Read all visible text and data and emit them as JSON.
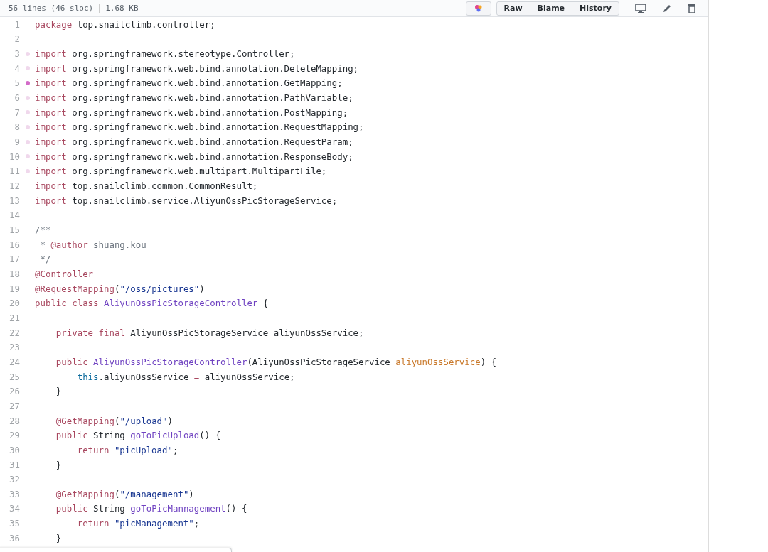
{
  "file_header": {
    "info": "56 lines (46 sloc)",
    "size": "1.68 KB",
    "buttons": [
      "Raw",
      "Blame",
      "History"
    ]
  },
  "lines": [
    {
      "n": "1",
      "changed": false,
      "highlighted": false,
      "tokens": [
        {
          "kind": "kw",
          "t": "package"
        },
        {
          "kind": "plain",
          "t": " top.snailclimb.controller;"
        }
      ]
    },
    {
      "n": "2",
      "changed": false,
      "highlighted": false
    },
    {
      "n": "3",
      "changed": true,
      "highlighted": false,
      "tokens": [
        {
          "kind": "kw",
          "t": "import"
        },
        {
          "kind": "plain",
          "t": " org.springframework.stereotype.Controller;"
        }
      ]
    },
    {
      "n": "4",
      "changed": true,
      "highlighted": false,
      "tokens": [
        {
          "kind": "kw",
          "t": "import"
        },
        {
          "kind": "plain",
          "t": " org.springframework.web.bind.annotation.DeleteMapping;"
        }
      ]
    },
    {
      "n": "5",
      "changed": true,
      "highlighted": true,
      "tokens": [
        {
          "kind": "kw",
          "t": "import "
        },
        {
          "kind": "link",
          "t": "org.springframework.web.bind.annotation.GetMapping"
        },
        {
          "kind": "plain",
          "t": ";"
        }
      ]
    },
    {
      "n": "6",
      "changed": true,
      "highlighted": false,
      "tokens": [
        {
          "kind": "kw",
          "t": "import"
        },
        {
          "kind": "plain",
          "t": " org.springframework.web.bind.annotation.PathVariable;"
        }
      ]
    },
    {
      "n": "7",
      "changed": true,
      "highlighted": false,
      "tokens": [
        {
          "kind": "kw",
          "t": "import"
        },
        {
          "kind": "plain",
          "t": " org.springframework.web.bind.annotation.PostMapping;"
        }
      ]
    },
    {
      "n": "8",
      "changed": true,
      "highlighted": false,
      "tokens": [
        {
          "kind": "kw",
          "t": "import"
        },
        {
          "kind": "plain",
          "t": " org.springframework.web.bind.annotation.RequestMapping;"
        }
      ]
    },
    {
      "n": "9",
      "changed": true,
      "highlighted": false,
      "tokens": [
        {
          "kind": "kw",
          "t": "import"
        },
        {
          "kind": "plain",
          "t": " org.springframework.web.bind.annotation.RequestParam;"
        }
      ]
    },
    {
      "n": "10",
      "changed": true,
      "highlighted": false,
      "tokens": [
        {
          "kind": "kw",
          "t": "import"
        },
        {
          "kind": "plain",
          "t": " org.springframework.web.bind.annotation.ResponseBody;"
        }
      ]
    },
    {
      "n": "11",
      "changed": true,
      "highlighted": false,
      "tokens": [
        {
          "kind": "kw",
          "t": "import"
        },
        {
          "kind": "plain",
          "t": " org.springframework.web.multipart.MultipartFile;"
        }
      ]
    },
    {
      "n": "12",
      "changed": false,
      "highlighted": false,
      "tokens": [
        {
          "kind": "kw",
          "t": "import"
        },
        {
          "kind": "plain",
          "t": " top.snailclimb.common.CommonResult;"
        }
      ]
    },
    {
      "n": "13",
      "changed": false,
      "highlighted": false,
      "tokens": [
        {
          "kind": "kw",
          "t": "import"
        },
        {
          "kind": "plain",
          "t": " top.snailclimb.service.AliyunOssPicStorageService;"
        }
      ]
    },
    {
      "n": "14",
      "changed": false,
      "highlighted": false
    },
    {
      "n": "15",
      "changed": false,
      "highlighted": false,
      "tokens": [
        {
          "kind": "comment",
          "t": "/**"
        }
      ]
    },
    {
      "n": "16",
      "changed": false,
      "highlighted": false,
      "tokens": [
        {
          "kind": "comment",
          "t": " * "
        },
        {
          "kind": "kw",
          "t": "@author"
        },
        {
          "kind": "comment",
          "t": " shuang.kou"
        }
      ]
    },
    {
      "n": "17",
      "changed": false,
      "highlighted": false,
      "tokens": [
        {
          "kind": "comment",
          "t": " */"
        }
      ]
    },
    {
      "n": "18",
      "changed": false,
      "highlighted": false,
      "tokens": [
        {
          "kind": "kw",
          "t": "@Controller"
        }
      ]
    },
    {
      "n": "19",
      "changed": false,
      "highlighted": false,
      "tokens": [
        {
          "kind": "kw",
          "t": "@RequestMapping"
        },
        {
          "kind": "plain",
          "t": "("
        },
        {
          "kind": "str",
          "t": "\"/oss/pictures\""
        },
        {
          "kind": "plain",
          "t": ")"
        }
      ]
    },
    {
      "n": "20",
      "changed": false,
      "highlighted": false,
      "tokens": [
        {
          "kind": "kw",
          "t": "public"
        },
        {
          "kind": "kw",
          "t": " class"
        },
        {
          "kind": "cls",
          "t": " AliyunOssPicStorageController"
        },
        {
          "kind": "plain",
          "t": " {"
        }
      ]
    },
    {
      "n": "21",
      "changed": false,
      "highlighted": false
    },
    {
      "n": "22",
      "changed": false,
      "highlighted": false,
      "tokens": [
        {
          "kind": "kw",
          "t": "    private"
        },
        {
          "kind": "kw",
          "t": " final"
        },
        {
          "kind": "plain",
          "t": " AliyunOssPicStorageService aliyunOssService;"
        }
      ]
    },
    {
      "n": "23",
      "changed": false,
      "highlighted": false
    },
    {
      "n": "24",
      "changed": false,
      "highlighted": false,
      "tokens": [
        {
          "kind": "kw",
          "t": "    public"
        },
        {
          "kind": "cls",
          "t": " AliyunOssPicStorageController"
        },
        {
          "kind": "plain",
          "t": "(AliyunOssPicStorageService "
        },
        {
          "kind": "param",
          "t": "aliyunOssService"
        },
        {
          "kind": "plain",
          "t": ") {"
        }
      ]
    },
    {
      "n": "25",
      "changed": false,
      "highlighted": false,
      "tokens": [
        {
          "kind": "this",
          "t": "        this"
        },
        {
          "kind": "plain",
          "t": ".aliyunOssService "
        },
        {
          "kind": "kw",
          "t": "="
        },
        {
          "kind": "plain",
          "t": " aliyunOssService;"
        }
      ]
    },
    {
      "n": "26",
      "changed": false,
      "highlighted": false,
      "tokens": [
        {
          "kind": "plain",
          "t": "    }"
        }
      ]
    },
    {
      "n": "27",
      "changed": false,
      "highlighted": false
    },
    {
      "n": "28",
      "changed": false,
      "highlighted": false,
      "tokens": [
        {
          "kind": "kw",
          "t": "    @GetMapping"
        },
        {
          "kind": "plain",
          "t": "("
        },
        {
          "kind": "str",
          "t": "\"/upload\""
        },
        {
          "kind": "plain",
          "t": ")"
        }
      ]
    },
    {
      "n": "29",
      "changed": false,
      "highlighted": false,
      "tokens": [
        {
          "kind": "kw",
          "t": "    public"
        },
        {
          "kind": "plain",
          "t": " String "
        },
        {
          "kind": "cls",
          "t": "goToPicUpload"
        },
        {
          "kind": "plain",
          "t": "() {"
        }
      ]
    },
    {
      "n": "30",
      "changed": false,
      "highlighted": false,
      "tokens": [
        {
          "kind": "kw",
          "t": "        return"
        },
        {
          "kind": "str",
          "t": " \"picUpload\""
        },
        {
          "kind": "plain",
          "t": ";"
        }
      ]
    },
    {
      "n": "31",
      "changed": false,
      "highlighted": false,
      "tokens": [
        {
          "kind": "plain",
          "t": "    }"
        }
      ]
    },
    {
      "n": "32",
      "changed": false,
      "highlighted": false
    },
    {
      "n": "33",
      "changed": false,
      "highlighted": false,
      "tokens": [
        {
          "kind": "kw",
          "t": "    @GetMapping"
        },
        {
          "kind": "plain",
          "t": "("
        },
        {
          "kind": "str",
          "t": "\"/management\""
        },
        {
          "kind": "plain",
          "t": ")"
        }
      ]
    },
    {
      "n": "34",
      "changed": false,
      "highlighted": false,
      "tokens": [
        {
          "kind": "kw",
          "t": "    public"
        },
        {
          "kind": "plain",
          "t": " String "
        },
        {
          "kind": "cls",
          "t": "goToPicMannagement"
        },
        {
          "kind": "plain",
          "t": "() {"
        }
      ]
    },
    {
      "n": "35",
      "changed": false,
      "highlighted": false,
      "tokens": [
        {
          "kind": "kw",
          "t": "        return"
        },
        {
          "kind": "str",
          "t": " \"picManagement\""
        },
        {
          "kind": "plain",
          "t": ";"
        }
      ]
    },
    {
      "n": "36",
      "changed": false,
      "highlighted": false,
      "tokens": [
        {
          "kind": "plain",
          "t": "    }"
        }
      ]
    }
  ]
}
